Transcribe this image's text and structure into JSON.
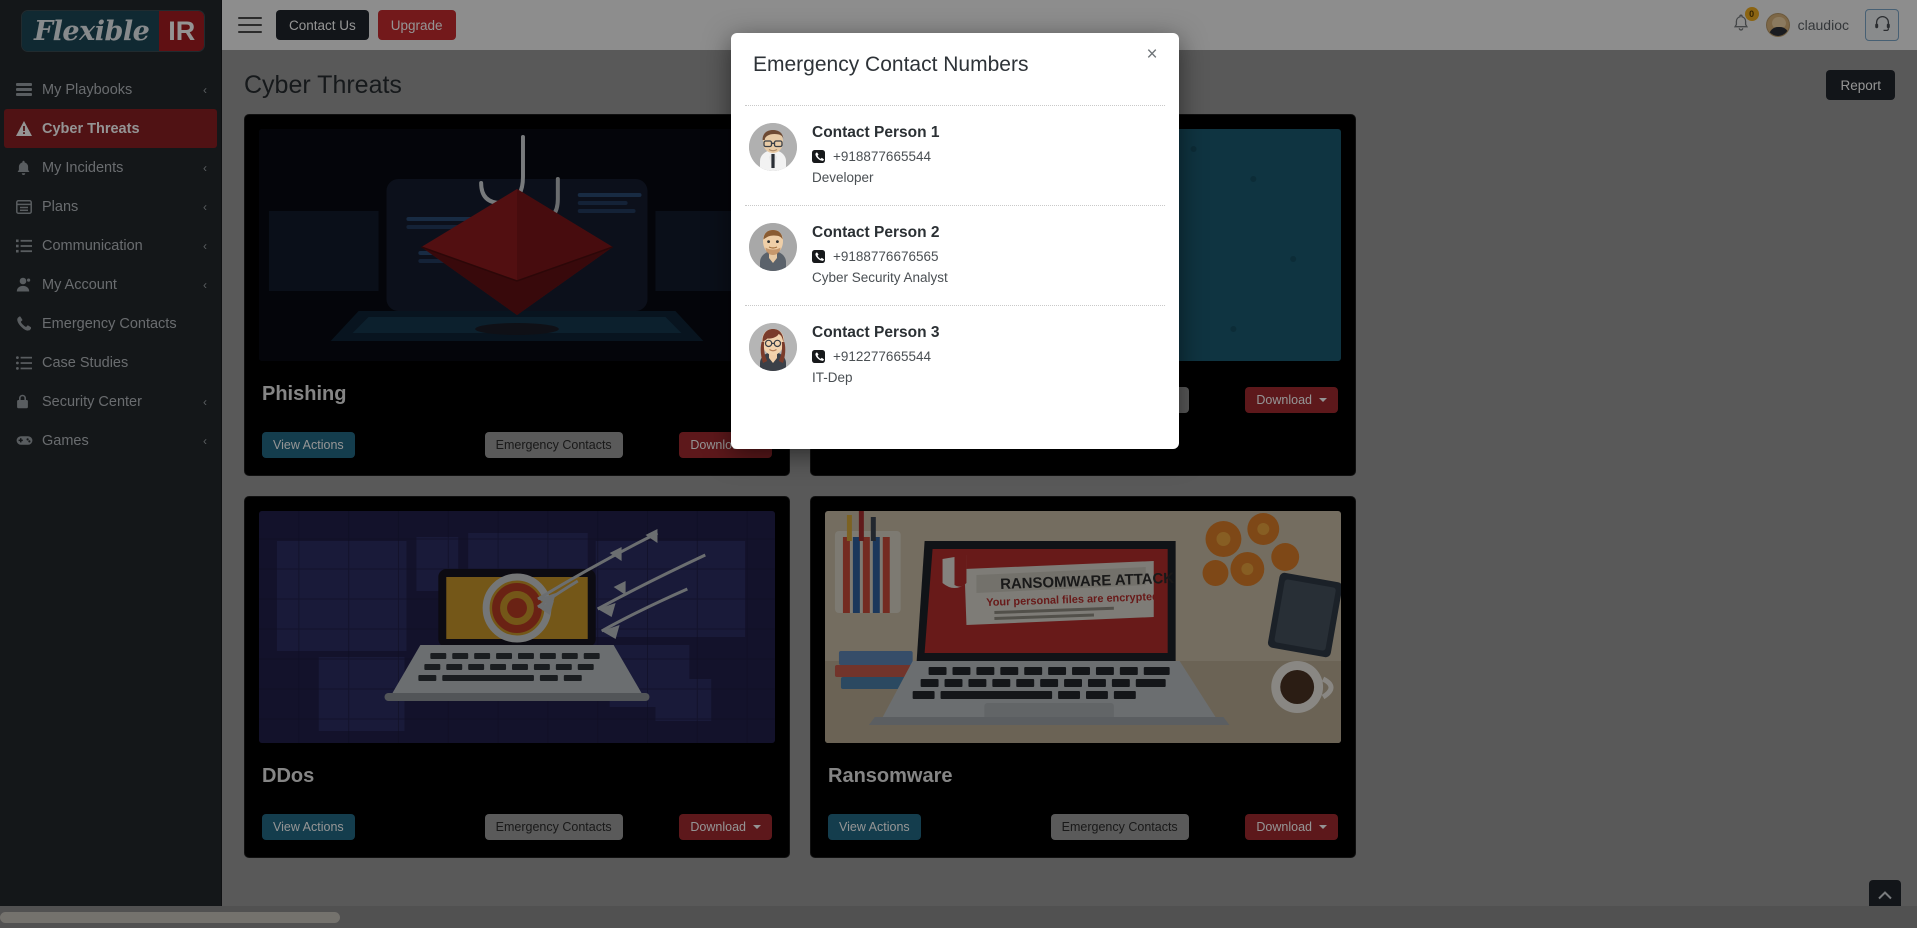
{
  "brand": {
    "logo_left": "Flexible",
    "logo_right": "IR",
    "accent_red": "#a51d22",
    "accent_teal": "#1d4756"
  },
  "sidebar": {
    "items": [
      {
        "label": "My Playbooks",
        "icon": "playbook-icon",
        "chevron": "‹",
        "active": false
      },
      {
        "label": "Cyber Threats",
        "icon": "warning-icon",
        "chevron": "",
        "active": true
      },
      {
        "label": "My Incidents",
        "icon": "bell-icon",
        "chevron": "‹",
        "active": false
      },
      {
        "label": "Plans",
        "icon": "plan-icon",
        "chevron": "‹",
        "active": false
      },
      {
        "label": "Communication",
        "icon": "list-icon",
        "chevron": "‹",
        "active": false
      },
      {
        "label": "My Account",
        "icon": "user-icon",
        "chevron": "‹",
        "active": false
      },
      {
        "label": "Emergency Contacts",
        "icon": "phone-icon",
        "chevron": "",
        "active": false
      },
      {
        "label": "Case Studies",
        "icon": "checklist-icon",
        "chevron": "",
        "active": false
      },
      {
        "label": "Security Center",
        "icon": "lock-icon",
        "chevron": "‹",
        "active": false
      },
      {
        "label": "Games",
        "icon": "gamepad-icon",
        "chevron": "‹",
        "active": false
      }
    ]
  },
  "topbar": {
    "menu_icon": "hamburger-icon",
    "contact_us_label": "Contact Us",
    "upgrade_label": "Upgrade",
    "notification_icon": "bell-icon",
    "notification_count": "0",
    "user_name": "claudioc",
    "support_icon": "headset-icon"
  },
  "main": {
    "page_title": "Cyber Threats",
    "report_label": "Report",
    "scroll_top_icon": "chevron-up-icon",
    "buttons": {
      "view_actions": "View Actions",
      "emergency_contacts": "Emergency Contacts",
      "download": "Download"
    },
    "cards": [
      {
        "title": "Phishing",
        "image": "phishing-hook-envelope-illustration"
      },
      {
        "title": "",
        "image": "malware-teal-illustration"
      },
      {
        "title": "DDos",
        "image": "ddos-world-map-laptop-illustration"
      },
      {
        "title": "Ransomware",
        "image": "ransomware-laptop-photo"
      }
    ]
  },
  "modal": {
    "title": "Emergency Contact Numbers",
    "close_label": "×",
    "contacts": [
      {
        "name": "Contact Person 1",
        "phone": "+918877665544",
        "role": "Developer",
        "avatar": "man-with-glasses-avatar"
      },
      {
        "name": "Contact Person 2",
        "phone": "+9188776676565",
        "role": "Cyber Security Analyst",
        "avatar": "man-with-beard-avatar"
      },
      {
        "name": "Contact Person 3",
        "phone": "+912277665544",
        "role": "IT-Dep",
        "avatar": "woman-with-glasses-avatar"
      }
    ]
  }
}
